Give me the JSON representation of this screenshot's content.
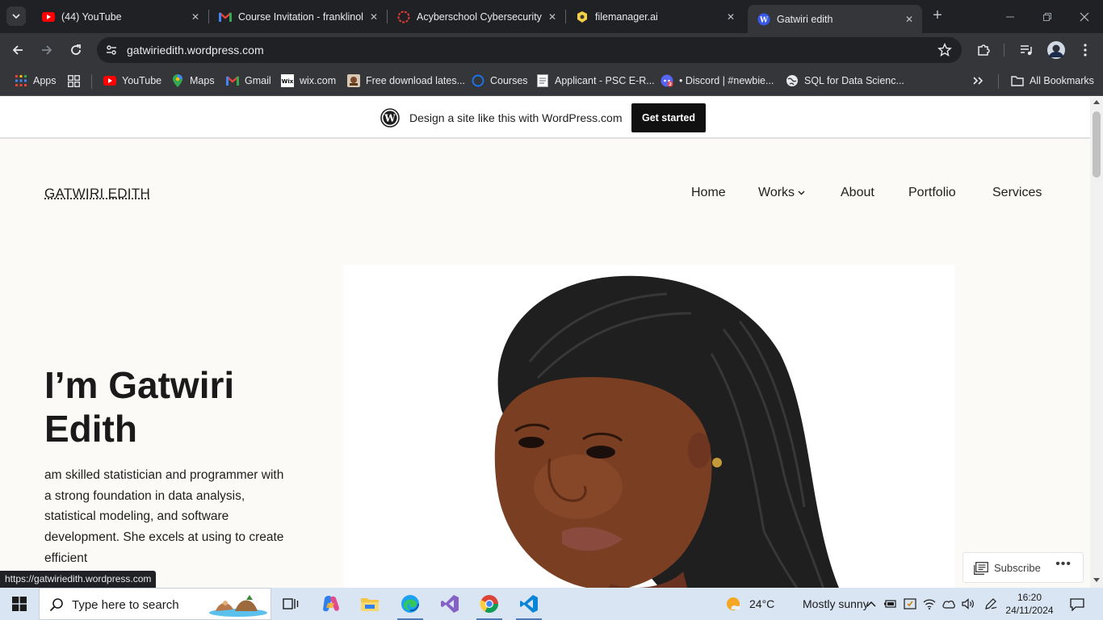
{
  "browser": {
    "tabs": [
      {
        "title": "(44) YouTube",
        "icon": "youtube-icon",
        "active": false
      },
      {
        "title": "Course Invitation - franklinol",
        "icon": "gmail-icon",
        "active": false
      },
      {
        "title": "Acyberschool Cybersecurity",
        "icon": "acyberschool-icon",
        "active": false
      },
      {
        "title": "filemanager.ai",
        "icon": "filemanager-icon",
        "active": false
      },
      {
        "title": "Gatwiri edith",
        "icon": "wordpress-icon",
        "active": true
      }
    ],
    "url": "gatwiriedith.wordpress.com",
    "bookmarks": [
      {
        "label": "Apps",
        "icon": "apps-grid-icon"
      },
      {
        "label": "YouTube",
        "icon": "youtube-icon"
      },
      {
        "label": "Maps",
        "icon": "maps-icon"
      },
      {
        "label": "Gmail",
        "icon": "gmail-icon"
      },
      {
        "label": "wix.com",
        "icon": "wix-icon"
      },
      {
        "label": "Free download lates...",
        "icon": "download-site-icon"
      },
      {
        "label": "Courses",
        "icon": "courses-icon"
      },
      {
        "label": "Applicant - PSC E-R...",
        "icon": "document-icon"
      },
      {
        "label": "• Discord | #newbie...",
        "icon": "discord-icon"
      },
      {
        "label": "SQL for Data Scienc...",
        "icon": "globe-icon"
      }
    ],
    "all_bookmarks_label": "All Bookmarks",
    "status_url": "https://gatwiriedith.wordpress.com"
  },
  "wp_banner": {
    "text": "Design a site like this with WordPress.com",
    "button": "Get started"
  },
  "site": {
    "title": "GATWIRI EDITH",
    "nav": [
      {
        "label": "Home"
      },
      {
        "label": "Works",
        "has_submenu": true
      },
      {
        "label": "About"
      },
      {
        "label": "Portfolio"
      },
      {
        "label": "Services"
      }
    ],
    "hero_title": "I’m Gatwiri Edith",
    "hero_text": "am skilled statistician and programmer with a strong foundation in data analysis, statistical modeling, and software development. She excels at using                 to create efficient"
  },
  "subscribe": {
    "label": "Subscribe",
    "more": "•••"
  },
  "taskbar": {
    "search_placeholder": "Type here to search",
    "weather": {
      "temp": "24°C",
      "condition": "Mostly sunny"
    },
    "time": "16:20",
    "date": "24/11/2024",
    "apps": [
      "task-view-icon",
      "copilot-icon",
      "file-explorer-icon",
      "edge-icon",
      "visual-studio-icon",
      "chrome-icon",
      "vscode-icon"
    ]
  },
  "colors": {
    "chrome_dark": "#202124",
    "chrome_toolbar": "#35363a",
    "page_bg": "#fbfaf6",
    "taskbar_bg": "#d9e5f3",
    "accent": "#101010"
  }
}
